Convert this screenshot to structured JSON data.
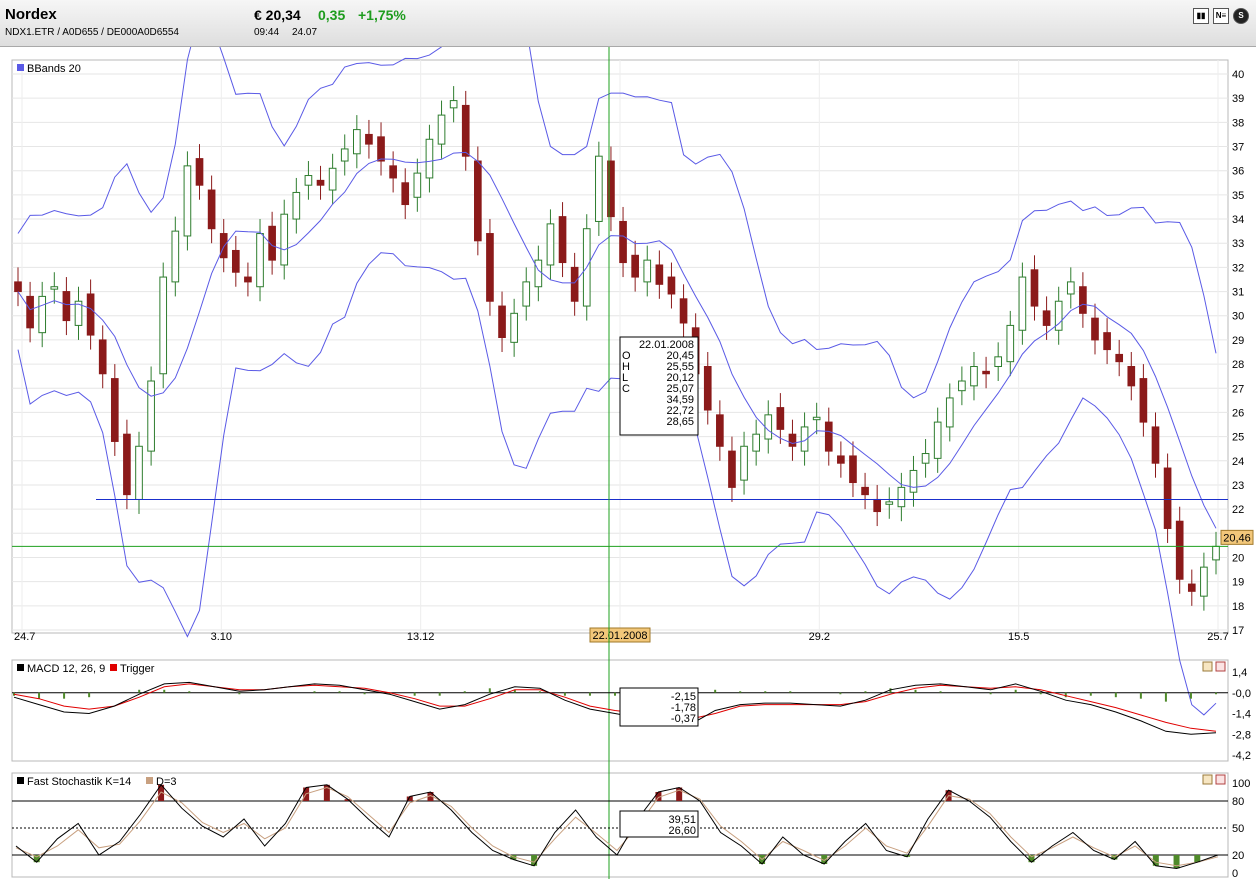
{
  "header": {
    "name": "Nordex",
    "ids": "NDX1.ETR   /   A0D655   /   DE000A0D6554",
    "price": "€ 20,34",
    "change": "0,35",
    "change_pct": "+1,75%",
    "time": "09:44",
    "date": "24.07",
    "toolbar_icons": [
      "bar-chart-icon",
      "news-icon",
      "settings-icon"
    ]
  },
  "colors": {
    "up": "#2e7d2e",
    "down": "#8b1a1a",
    "band": "#5a5ae6",
    "macd": "#000000",
    "trigger": "#e00000",
    "stoch_d": "#c8a080",
    "hist_pos": "#4f8a2a",
    "crosshair": "#1fa01f",
    "hline": "#1a2fcc"
  },
  "chart_data": [
    {
      "type": "candlestick",
      "legend": "BBands 20",
      "ylim": [
        17,
        40
      ],
      "yticks": [
        17,
        18,
        19,
        20,
        21,
        22,
        23,
        24,
        25,
        26,
        27,
        28,
        29,
        30,
        31,
        32,
        33,
        34,
        35,
        36,
        37,
        38,
        39,
        40
      ],
      "xtick_labels": [
        "24.7",
        "3.10",
        "13.12",
        "22.01.2008",
        "29.2",
        "15.5",
        "25.7"
      ],
      "last_price_label": "20,46",
      "horizontal_line": 22.4,
      "crosshair_price": 20.46,
      "close_series": [
        31.0,
        29.5,
        30.8,
        31.2,
        29.8,
        30.6,
        29.2,
        27.6,
        24.8,
        22.6,
        24.6,
        27.3,
        31.6,
        33.5,
        36.2,
        35.4,
        33.6,
        32.4,
        31.8,
        31.4,
        33.4,
        32.3,
        34.2,
        35.1,
        35.8,
        35.4,
        36.1,
        36.9,
        37.7,
        37.1,
        36.4,
        35.7,
        34.6,
        35.9,
        37.3,
        38.3,
        38.9,
        36.6,
        33.1,
        30.6,
        29.1,
        30.1,
        31.4,
        32.3,
        33.8,
        32.2,
        30.6,
        33.6,
        36.6,
        34.1,
        32.2,
        31.6,
        32.3,
        31.3,
        30.9,
        29.7,
        27.6,
        26.1,
        24.6,
        22.9,
        24.6,
        25.1,
        25.9,
        25.3,
        24.6,
        25.4,
        25.8,
        24.4,
        23.9,
        23.1,
        22.6,
        21.9,
        22.3,
        22.9,
        23.6,
        24.3,
        25.6,
        26.6,
        27.3,
        27.9,
        27.6,
        28.3,
        29.6,
        31.6,
        30.4,
        29.6,
        30.6,
        31.4,
        30.1,
        29.0,
        28.6,
        28.1,
        27.1,
        25.6,
        23.9,
        21.2,
        19.1,
        18.6,
        19.6,
        20.46
      ],
      "candles": [
        {
          "date": "22.01.2008",
          "open": 20.45,
          "high": 25.55,
          "low": 20.12,
          "close": 25.07
        }
      ],
      "bbands": {
        "upper": 34.59,
        "middle": 22.72,
        "lower": 28.65
      }
    },
    {
      "type": "line",
      "legend": "MACD 12, 26, 9",
      "trigger_legend": "Trigger",
      "ylim": [
        -4.2,
        1.4
      ],
      "ytick_labels": [
        "1,4",
        "-0,0",
        "-1,4",
        "-2,8",
        "-4,2"
      ],
      "series": [
        {
          "name": "MACD 12, 26, 9",
          "values": [
            -0.3,
            -0.8,
            -1.3,
            -1.4,
            -0.9,
            -0.1,
            0.6,
            0.7,
            0.4,
            0.1,
            0.2,
            0.4,
            0.6,
            0.5,
            0.2,
            -0.1,
            -0.6,
            -1.1,
            -0.8,
            -0.1,
            0.4,
            0.3,
            -0.5,
            -1.1,
            -1.4,
            -1.7,
            -2.0,
            -2.15,
            -1.2,
            -0.8,
            -0.7,
            -0.7,
            -0.8,
            -0.9,
            -0.5,
            0.2,
            0.5,
            0.6,
            0.4,
            0.2,
            0.6,
            0.1,
            -0.5,
            -0.8,
            -1.3,
            -1.9,
            -2.6,
            -2.8,
            -2.7
          ]
        },
        {
          "name": "Trigger",
          "values": [
            -0.1,
            -0.4,
            -0.9,
            -1.1,
            -0.9,
            -0.3,
            0.4,
            0.6,
            0.4,
            0.2,
            0.2,
            0.4,
            0.5,
            0.4,
            0.3,
            0.0,
            -0.4,
            -0.9,
            -0.9,
            -0.4,
            0.2,
            0.2,
            -0.3,
            -0.9,
            -1.2,
            -1.4,
            -1.7,
            -1.78,
            -1.4,
            -0.9,
            -0.8,
            -0.8,
            -0.8,
            -0.8,
            -0.6,
            -0.1,
            0.3,
            0.5,
            0.4,
            0.3,
            0.4,
            0.2,
            -0.2,
            -0.6,
            -1.0,
            -1.5,
            -2.0,
            -2.4,
            -2.6
          ]
        }
      ],
      "readout": [
        "-2,15",
        "-1,78",
        "-0,37"
      ]
    },
    {
      "type": "line",
      "legend": "Fast Stochastik K=14",
      "d_legend": "D=3",
      "ylim": [
        0,
        100
      ],
      "ytick_labels": [
        "100",
        "80",
        "50",
        "20",
        "0"
      ],
      "series": [
        {
          "name": "Fast Stochastik K=14",
          "values": [
            30,
            12,
            38,
            55,
            20,
            35,
            65,
            98,
            72,
            52,
            40,
            60,
            30,
            55,
            95,
            98,
            82,
            60,
            40,
            85,
            90,
            70,
            45,
            25,
            15,
            8,
            45,
            70,
            40,
            20,
            60,
            90,
            95,
            80,
            45,
            30,
            10,
            40,
            20,
            10,
            35,
            55,
            25,
            18,
            60,
            92,
            80,
            62,
            35,
            12,
            30,
            45,
            25,
            15,
            35,
            8,
            5,
            12,
            20
          ]
        },
        {
          "name": "D=3",
          "values": [
            28,
            18,
            30,
            48,
            28,
            32,
            58,
            90,
            78,
            56,
            45,
            55,
            38,
            50,
            88,
            95,
            85,
            65,
            45,
            78,
            86,
            74,
            50,
            30,
            18,
            12,
            38,
            62,
            44,
            25,
            52,
            84,
            92,
            82,
            52,
            35,
            15,
            35,
            25,
            14,
            30,
            50,
            30,
            22,
            52,
            86,
            82,
            66,
            40,
            18,
            28,
            40,
            28,
            18,
            30,
            12,
            8,
            12,
            18
          ]
        }
      ],
      "readout": [
        "39,51",
        "26,60"
      ]
    }
  ]
}
